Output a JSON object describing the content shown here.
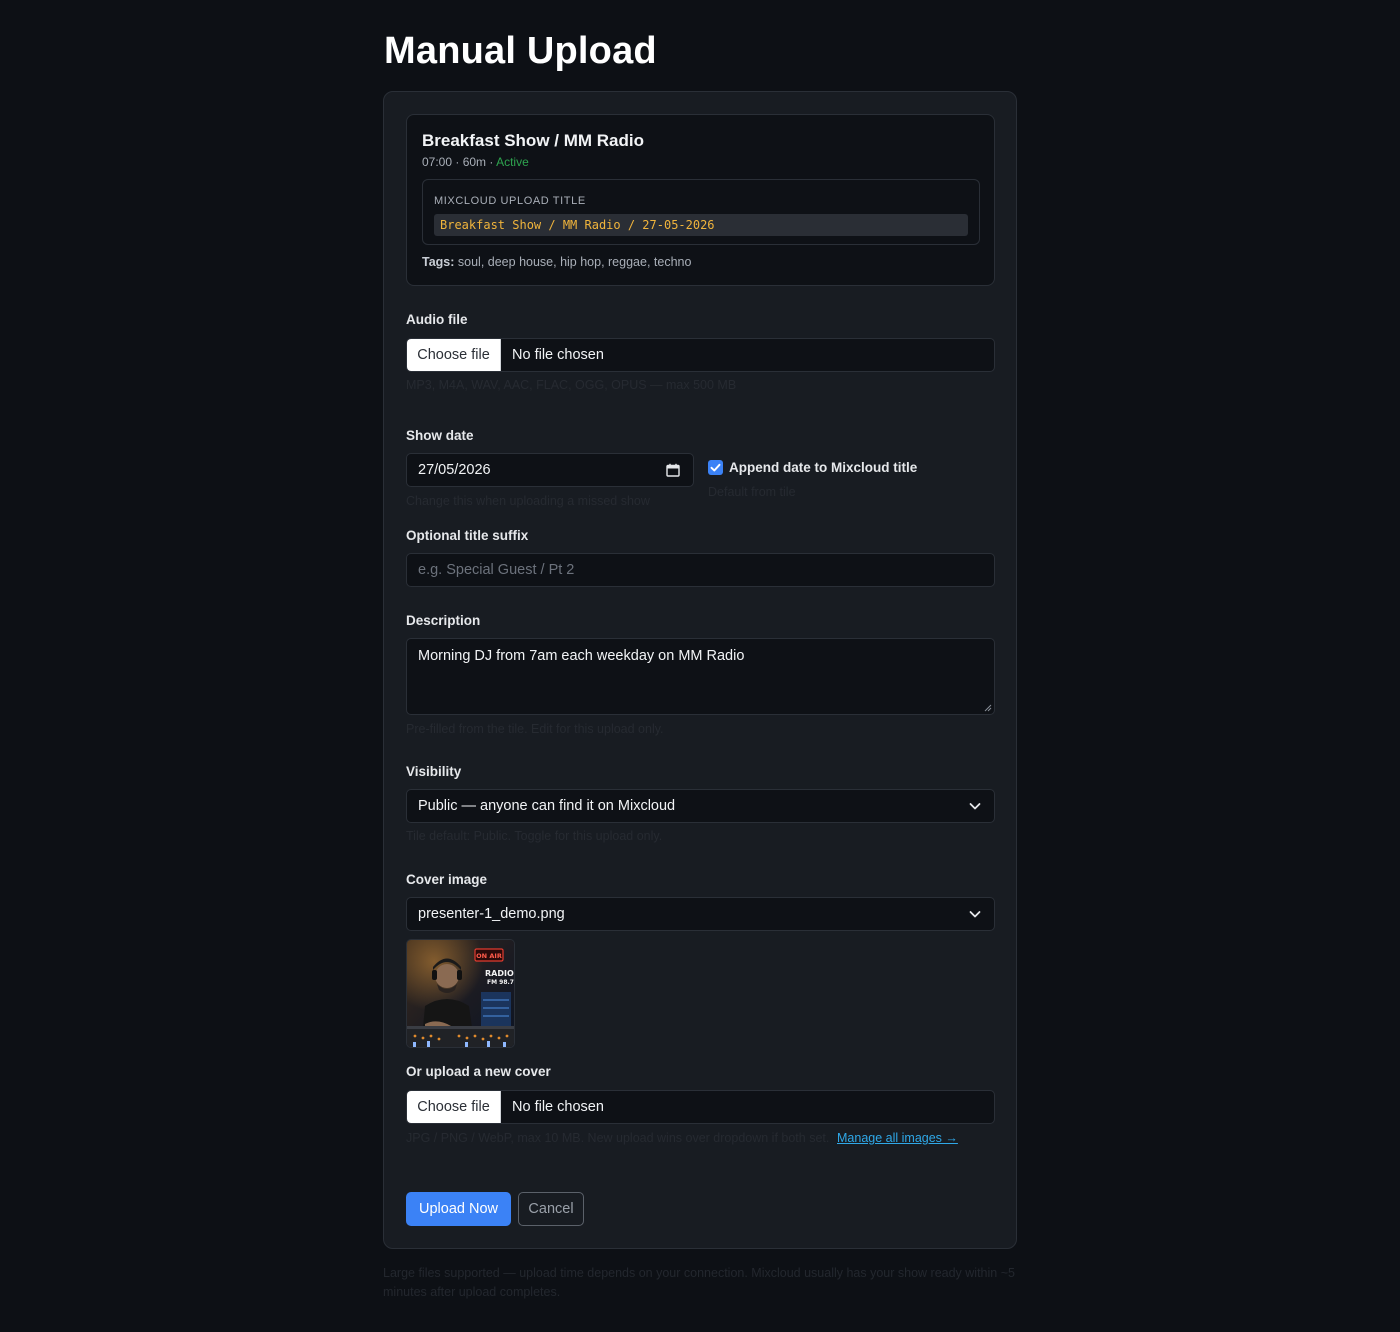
{
  "page": {
    "title": "Manual Upload"
  },
  "show": {
    "name": "Breakfast Show / MM Radio",
    "time": "07:00",
    "duration": "60m",
    "status": "Active",
    "mixcloud_label": "MIXCLOUD UPLOAD TITLE",
    "mixcloud_title": "Breakfast Show / MM Radio / 27-05-2026",
    "tags_label": "Tags:",
    "tags": "soul, deep house, hip hop, reggae, techno"
  },
  "audio": {
    "label": "Audio file",
    "button": "Choose file",
    "file_name": "No file chosen",
    "hint": "MP3, M4A, WAV, AAC, FLAC, OGG, OPUS — max 500 MB"
  },
  "show_date": {
    "label": "Show date",
    "value": "27/05/2026",
    "hint": "Change this when uploading a missed show",
    "append_label": "Append date to Mixcloud title",
    "append_checked": true,
    "append_hint": "Default from tile"
  },
  "suffix": {
    "label": "Optional title suffix",
    "placeholder": "e.g. Special Guest / Pt 2"
  },
  "description": {
    "label": "Description",
    "value": "Morning DJ from 7am each weekday on MM Radio",
    "hint": "Pre-filled from the tile. Edit for this upload only."
  },
  "visibility": {
    "label": "Visibility",
    "value": "Public — anyone can find it on Mixcloud",
    "hint": "Tile default: Public. Toggle for this upload only."
  },
  "cover": {
    "label": "Cover image",
    "value": "presenter-1_demo.png",
    "sign_on_air": "ON AIR",
    "sign_radio": "RADIO",
    "sign_fm": "FM 98.7"
  },
  "new_cover": {
    "label": "Or upload a new cover",
    "button": "Choose file",
    "file_name": "No file chosen",
    "hint": "JPG / PNG / WebP, max 10 MB. New upload wins over dropdown if both set.",
    "manage_link": "Manage all images →"
  },
  "actions": {
    "upload": "Upload Now",
    "cancel": "Cancel"
  },
  "footer": {
    "note": "Large files supported — upload time depends on your connection. Mixcloud usually has your show ready within ~5 minutes after upload completes."
  },
  "colors": {
    "accent": "#3b82f6",
    "status_active": "#2ea44f",
    "link": "#2fa8e8",
    "mono_title": "#f0b43c"
  }
}
